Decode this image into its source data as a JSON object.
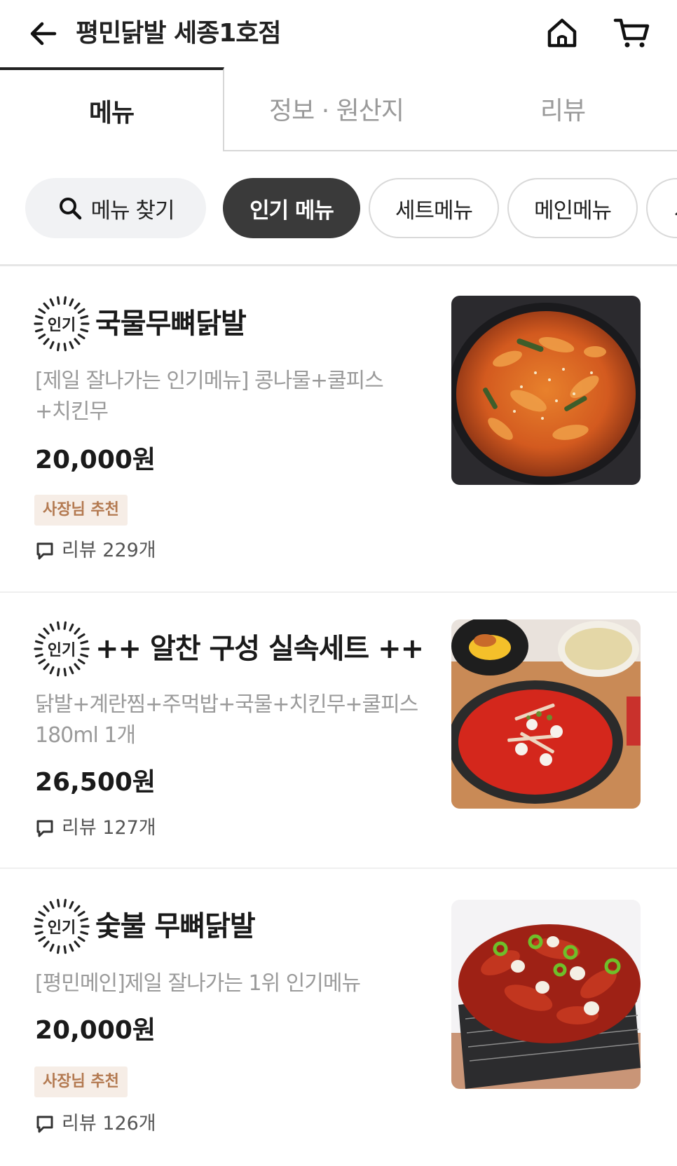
{
  "header": {
    "store_name": "평민닭발 세종1호점"
  },
  "tabs": [
    {
      "label": "메뉴"
    },
    {
      "label": "정보 · 원산지"
    },
    {
      "label": "리뷰"
    }
  ],
  "filters": {
    "search_label": "메뉴 찾기",
    "chips": [
      {
        "label": "인기 메뉴"
      },
      {
        "label": "세트메뉴"
      },
      {
        "label": "메인메뉴"
      },
      {
        "label": "사"
      }
    ]
  },
  "popular_badge": "인기",
  "items": [
    {
      "name": "국물무뼈닭발",
      "desc_line1": "[제일 잘나가는 인기메뉴] 콩나물+쿨피스",
      "desc_line2": "+치킨무",
      "price": "20,000원",
      "tag": "사장님 추천",
      "reviews": "리뷰 229개"
    },
    {
      "name": "++ 알찬 구성 실속세트 ++",
      "desc_line1": "닭발+계란찜+주먹밥+국물+치킨무+쿨피스",
      "desc_line2": "180ml 1개",
      "price": "26,500원",
      "reviews": "리뷰 127개"
    },
    {
      "name": "숯불 무뼈닭발",
      "desc_line1": "[평민메인]제일 잘나가는 1위 인기메뉴",
      "price": "20,000원",
      "tag": "사장님 추천",
      "reviews": "리뷰 126개"
    }
  ],
  "colors": {
    "active_chip": "#3a3a3a",
    "tag_bg": "#f6ede6",
    "tag_text": "#b37950",
    "muted_text": "#9a9a9a"
  }
}
